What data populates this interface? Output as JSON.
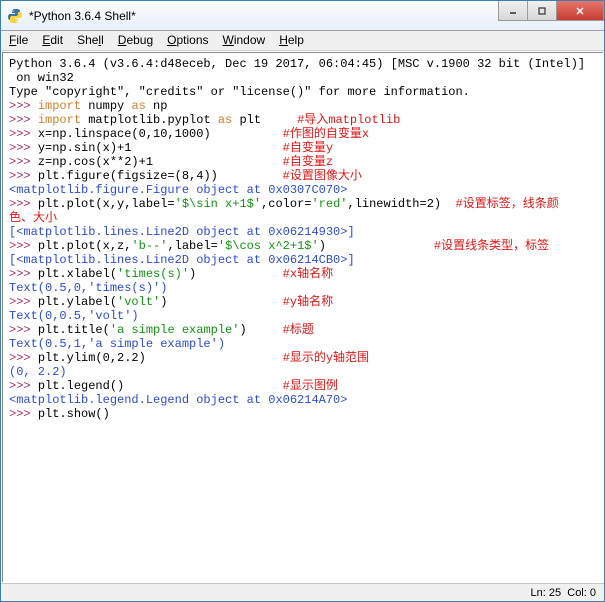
{
  "window": {
    "title": "*Python 3.6.4 Shell*"
  },
  "menu": {
    "file": "File",
    "edit": "Edit",
    "shell": "Shell",
    "debug": "Debug",
    "options": "Options",
    "window": "Window",
    "help": "Help"
  },
  "banner": {
    "l1": "Python 3.6.4 (v3.6.4:d48eceb, Dec 19 2017, 06:04:45) [MSC v.1900 32 bit (Intel)]",
    "l2": " on win32",
    "l3": "Type \"copyright\", \"credits\" or \"license()\" for more information."
  },
  "p": ">>> ",
  "kw_import": "import",
  "kw_as": "as",
  "lines": {
    "l1a": " numpy ",
    "l1b": " np",
    "l2a": " matplotlib.pyplot ",
    "l2b": " plt     ",
    "c2": "#导入matplotlib",
    "l3": "x=np.linspace(0,10,1000)          ",
    "c3": "#作图的自变量x",
    "l4": "y=np.sin(x)+1                     ",
    "c4": "#自变量y",
    "l5": "z=np.cos(x**2)+1                  ",
    "c5": "#自变量z",
    "l6": "plt.figure(figsize=(8,4))         ",
    "c6": "#设置图像大小",
    "out1": "<matplotlib.figure.Figure object at 0x0307C070>",
    "l7a": "plt.plot(x,y,label=",
    "l7s": "'$\\sin x+1$'",
    "l7b": ",color=",
    "l7s2": "'red'",
    "l7c": ",linewidth=2)  ",
    "c7": "#设置标签，线条颜",
    "c7b": "色、大小",
    "out2": "[<matplotlib.lines.Line2D object at 0x06214930>]",
    "l8a": "plt.plot(x,z,",
    "l8s": "'b--'",
    "l8b": ",label=",
    "l8s2": "'$\\cos x^2+1$'",
    "l8c": ")               ",
    "c8": "#设置线条类型，标签",
    "out3": "[<matplotlib.lines.Line2D object at 0x06214CB0>]",
    "l9a": "plt.xlabel(",
    "l9s": "'times(s)'",
    "l9b": ")            ",
    "c9": "#x轴名称",
    "out4": "Text(0.5,0,'times(s)')",
    "l10a": "plt.ylabel(",
    "l10s": "'volt'",
    "l10b": ")                ",
    "c10": "#y轴名称",
    "out5": "Text(0,0.5,'volt')",
    "l11a": "plt.title(",
    "l11s": "'a simple example'",
    "l11b": ")     ",
    "c11": "#标题",
    "out6": "Text(0.5,1,'a simple example')",
    "l12": "plt.ylim(0,2.2)                   ",
    "c12": "#显示的y轴范围",
    "out7": "(0, 2.2)",
    "l13": "plt.legend()                      ",
    "c13": "#显示图例",
    "out8": "<matplotlib.legend.Legend object at 0x06214A70>",
    "l14": "plt.show()"
  },
  "status": {
    "ln": "Ln: 25",
    "col": "Col: 0"
  }
}
